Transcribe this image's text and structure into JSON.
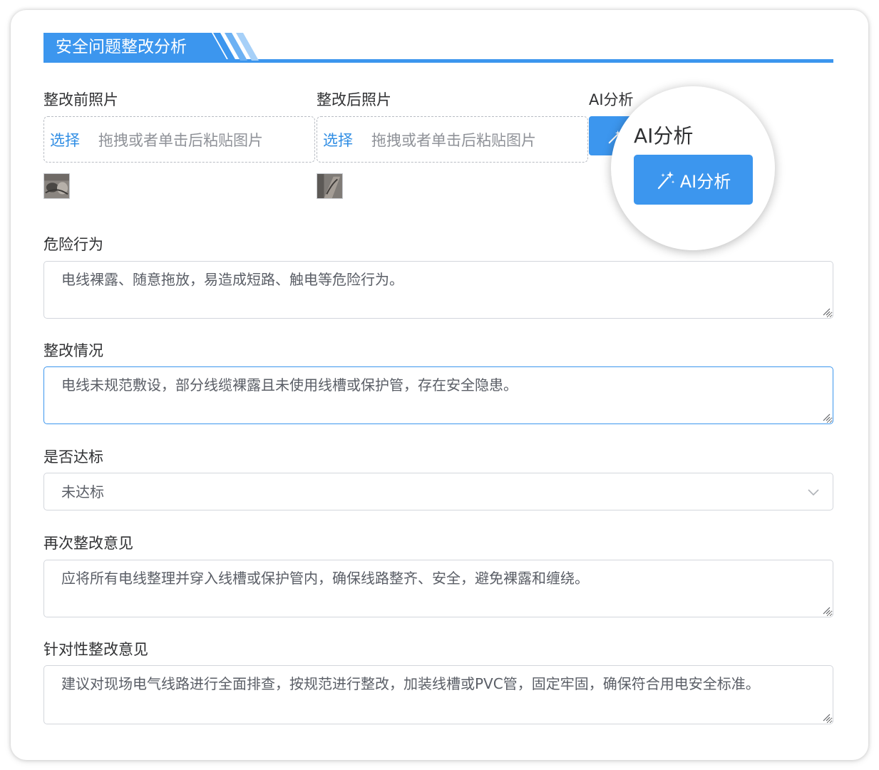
{
  "section": {
    "title": "安全问题整改分析"
  },
  "photos": {
    "before": {
      "label": "整改前照片",
      "select_label": "选择",
      "hint": "拖拽或者单击后粘贴图片"
    },
    "after": {
      "label": "整改后照片",
      "select_label": "选择",
      "hint": "拖拽或者单击后粘贴图片"
    }
  },
  "ai": {
    "label": "AI分析",
    "button_label": "AI分析",
    "zoom_label": "AI分析",
    "zoom_button_label": "AI分析"
  },
  "fields": {
    "dangerous_behavior": {
      "label": "危险行为",
      "value": "电线裸露、随意拖放，易造成短路、触电等危险行为。"
    },
    "rectification_status": {
      "label": "整改情况",
      "value": "电线未规范敷设，部分线缆裸露且未使用线槽或保护管，存在安全隐患。"
    },
    "compliance": {
      "label": "是否达标",
      "value": "未达标"
    },
    "re_rectification": {
      "label": "再次整改意见",
      "value": "应将所有电线整理并穿入线槽或保护管内，确保线路整齐、安全，避免裸露和缠绕。"
    },
    "targeted_advice": {
      "label": "针对性整改意见",
      "value": "建议对现场电气线路进行全面排查，按规范进行整改，加装线槽或PVC管，固定牢固，确保符合用电安全标准。"
    }
  },
  "colors": {
    "primary": "#3c96ee",
    "link": "#2f8de4",
    "placeholder": "#8f9298"
  },
  "icons": {
    "ai": "magic-wand-sparkle-icon",
    "select": "chevron-down-icon",
    "resize": "resize-grip-icon"
  }
}
